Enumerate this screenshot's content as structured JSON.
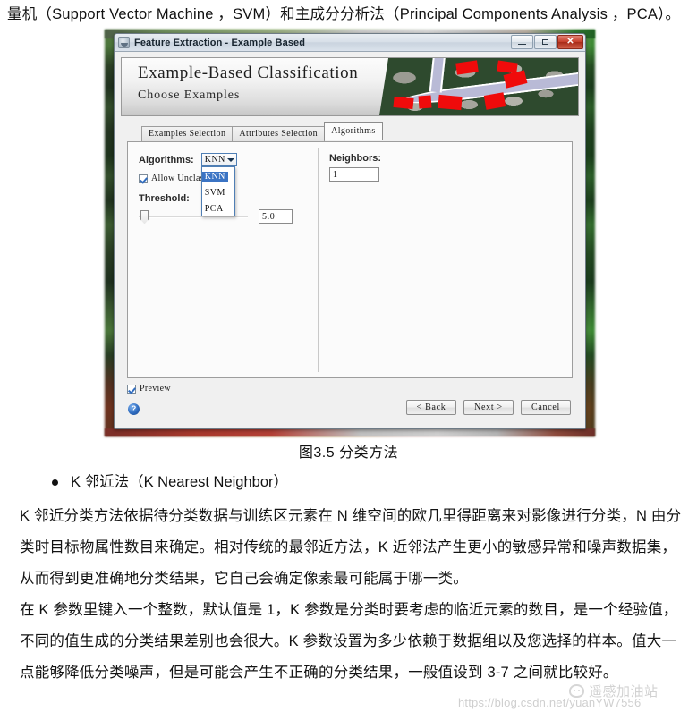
{
  "document": {
    "top_sentence": "量机（Support Vector Machine ，SVM）和主成分分析法（Principal Components Analysis ，PCA）。",
    "figure_caption": "图3.5    分类方法",
    "bullet_heading": "K 邻近法（K Nearest Neighbor）",
    "paragraphs": [
      "K 邻近分类方法依据待分类数据与训练区元素在 N 维空间的欧几里得距离来对影像进行分类，N 由分类时目标物属性数目来确定。相对传统的最邻近方法，K 近邻法产生更小的敏感异常和噪声数据集，从而得到更准确地分类结果，它自己会确定像素最可能属于哪一类。",
      "在 K 参数里键入一个整数，默认值是 1，K 参数是分类时要考虑的临近元素的数目，是一个经验值，不同的值生成的分类结果差别也会很大。K 参数设置为多少依赖于数据组以及您选择的样本。值大一点能够降低分类噪声，但是可能会产生不正确的分类结果，一般值设到 3-7 之间就比较好。"
    ]
  },
  "watermark": {
    "url": "https://blog.csdn.net/yuanYW7556",
    "logo_text": "遥感加油站"
  },
  "window": {
    "title": "Feature Extraction - Example Based",
    "title_icon": "app-icon",
    "controls": {
      "minimize": "minimize-icon",
      "maximize": "maximize-icon",
      "close": "✕"
    },
    "banner": {
      "heading": "Example-Based Classification",
      "subheading": "Choose Examples"
    },
    "tabs": [
      {
        "label": "Examples Selection",
        "selected": false
      },
      {
        "label": "Attributes Selection",
        "selected": false
      },
      {
        "label": "Algorithms",
        "selected": true
      }
    ],
    "algorithms_panel": {
      "algorithms_label": "Algorithms:",
      "algorithms_value": "KNN",
      "algorithms_options": [
        "KNN",
        "SVM",
        "PCA"
      ],
      "algorithms_selected_option": "KNN",
      "allow_unclassified_label": "Allow Unclassified",
      "allow_unclassified_checked": true,
      "threshold_label": "Threshold:",
      "threshold_value": "5.0",
      "neighbors_label": "Neighbors:",
      "neighbors_value": "1"
    },
    "footer": {
      "preview_label": "Preview",
      "preview_checked": true,
      "help_icon": "?",
      "back_button": "< Back",
      "next_button": "Next >",
      "cancel_button": "Cancel"
    }
  }
}
